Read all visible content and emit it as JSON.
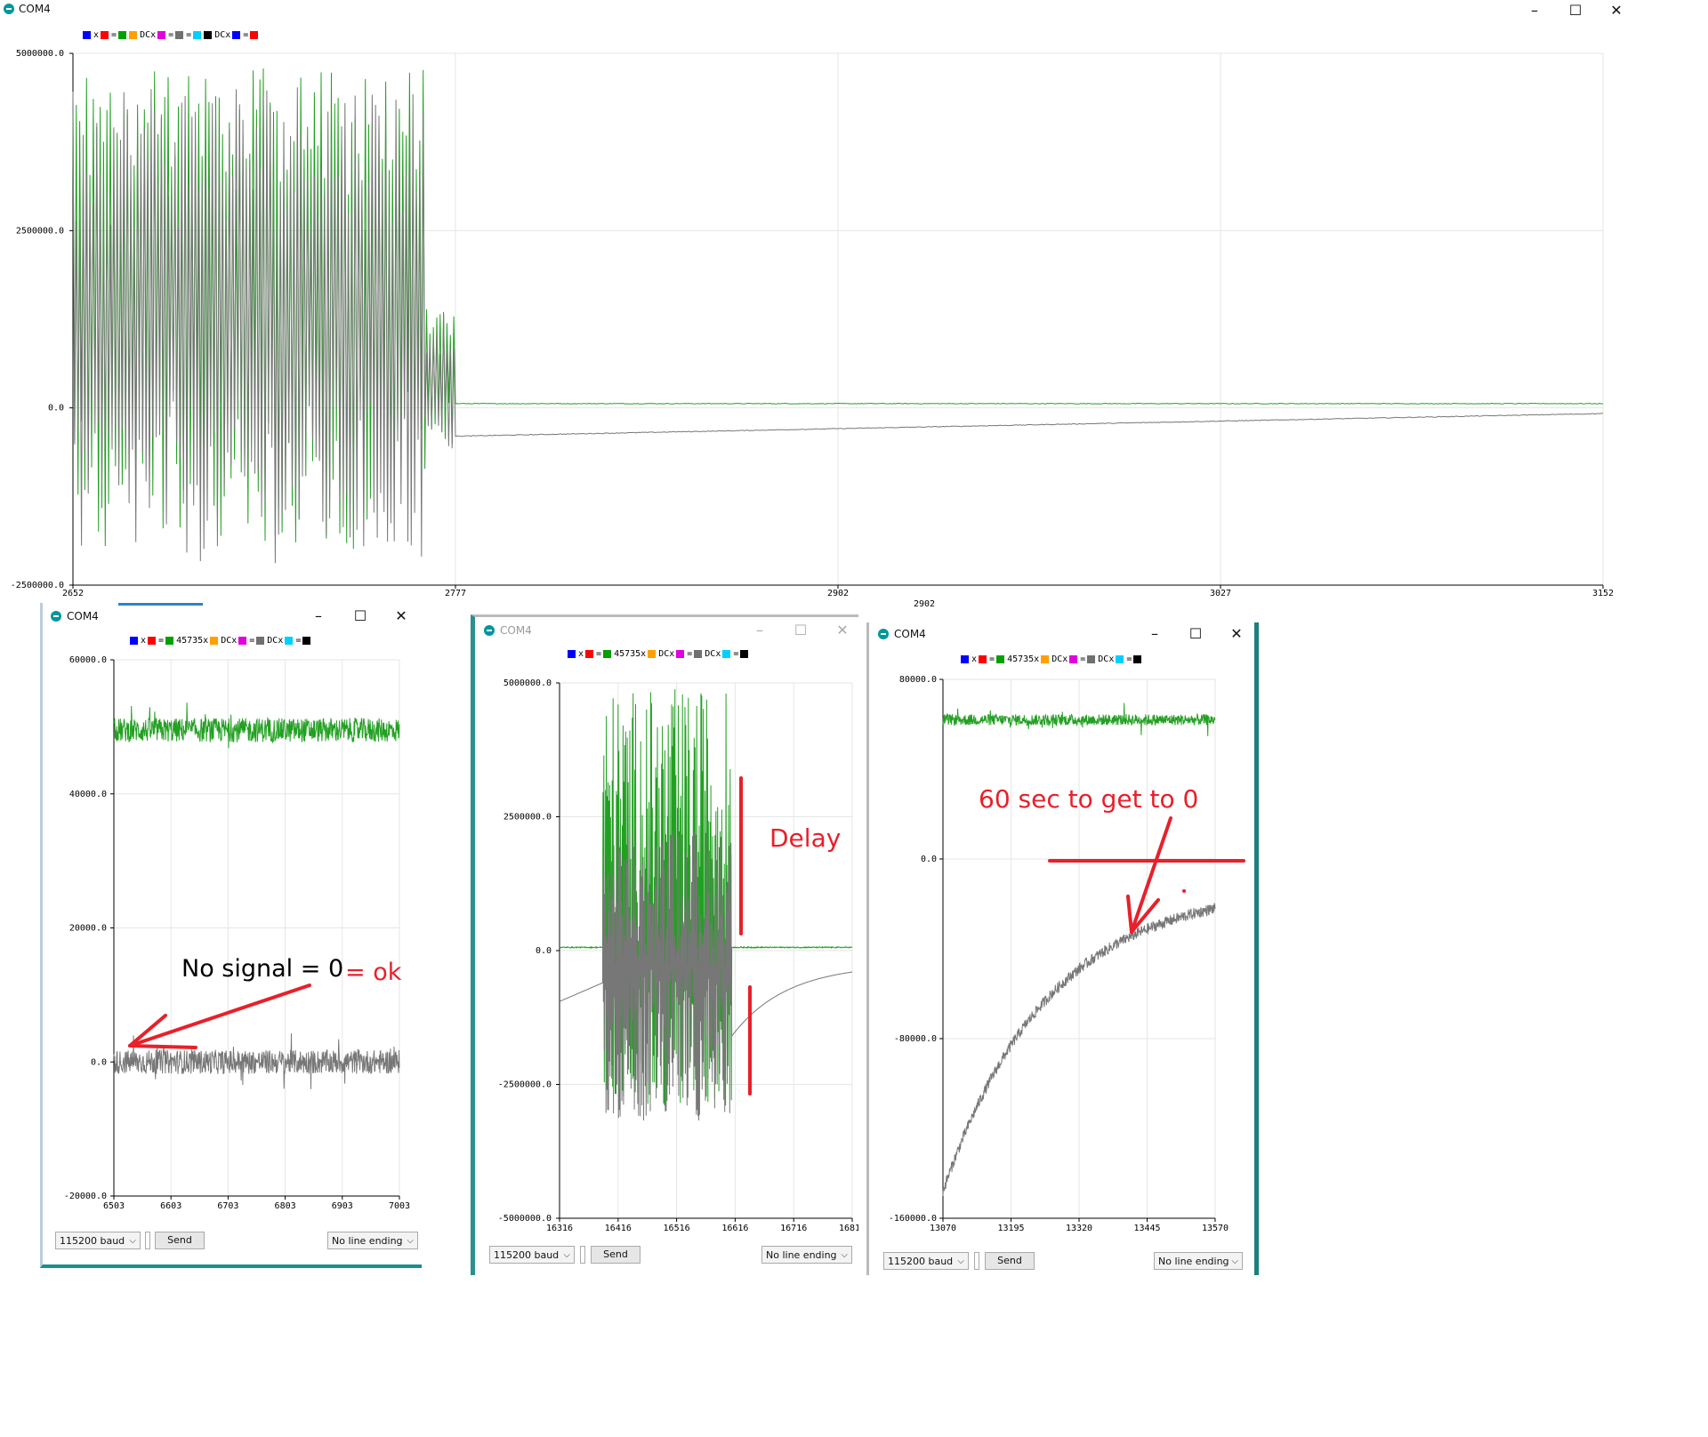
{
  "main": {
    "title": "COM4",
    "legend": [
      {
        "c": "#0000ff"
      },
      {
        "t": "x"
      },
      {
        "c": "#ff0000"
      },
      {
        "t": "="
      },
      {
        "c": "#00a000"
      },
      {
        "c": "#ffa000"
      },
      {
        "t": "DCx"
      },
      {
        "c": "#e000e0"
      },
      {
        "t": "="
      },
      {
        "c": "#707070"
      },
      {
        "t": "="
      },
      {
        "c": "#00d0ff"
      },
      {
        "c": "#000000"
      },
      {
        "t": "DCx"
      },
      {
        "c": "#0000ff"
      },
      {
        "t": "="
      },
      {
        "c": "#ff0000"
      }
    ],
    "chart_data": {
      "type": "line",
      "ylim": [
        -2500000,
        5000000
      ],
      "yticks": [
        "5000000.0",
        "2500000.0",
        "0.0",
        "-2500000.0"
      ],
      "xlim": [
        2652,
        3152
      ],
      "xticks": [
        "2652",
        "2777",
        "2902",
        "3027",
        "3152"
      ],
      "xtick_extra": "2902",
      "series": [
        {
          "color": "#22a022",
          "pattern": "burst-then-flat",
          "burst_end": 2777,
          "flat_value": 60000
        },
        {
          "color": "#777777",
          "pattern": "burst-then-recover",
          "burst_end": 2777,
          "start_value": -400000,
          "end_value": -80000
        }
      ]
    }
  },
  "win1": {
    "title": "COM4",
    "legend": [
      {
        "c": "#0000ff"
      },
      {
        "t": "x"
      },
      {
        "c": "#ff0000"
      },
      {
        "t": "="
      },
      {
        "c": "#00a000"
      },
      {
        "t": "45735x"
      },
      {
        "c": "#ffa000"
      },
      {
        "t": "DCx"
      },
      {
        "c": "#e000e0"
      },
      {
        "t": "="
      },
      {
        "c": "#707070"
      },
      {
        "t": "DCx"
      },
      {
        "c": "#00d0ff"
      },
      {
        "t": "="
      },
      {
        "c": "#000000"
      }
    ],
    "chart_data": {
      "type": "line",
      "ylim": [
        -20000,
        60000
      ],
      "yticks": [
        "60000.0",
        "40000.0",
        "20000.0",
        "0.0",
        "-20000.0"
      ],
      "xlim": [
        6503,
        7003
      ],
      "xticks": [
        "6503",
        "6603",
        "6703",
        "6803",
        "6903",
        "7003"
      ],
      "series": [
        {
          "color": "#22a022",
          "pattern": "noise",
          "mean": 49500,
          "amp": 1800
        },
        {
          "color": "#777777",
          "pattern": "noise",
          "mean": 0,
          "amp": 1800
        }
      ]
    },
    "annotation": {
      "text1": "No signal = 0",
      "text2": "= ok"
    },
    "bottom": {
      "baud": "115200 baud",
      "send": "Send",
      "ending": "No line ending"
    }
  },
  "win2": {
    "title": "COM4",
    "legend": [
      {
        "c": "#0000ff"
      },
      {
        "t": "x"
      },
      {
        "c": "#ff0000"
      },
      {
        "t": "="
      },
      {
        "c": "#00a000"
      },
      {
        "t": "45735x"
      },
      {
        "c": "#ffa000"
      },
      {
        "t": "DCx"
      },
      {
        "c": "#e000e0"
      },
      {
        "t": "="
      },
      {
        "c": "#707070"
      },
      {
        "t": "DCx"
      },
      {
        "c": "#00d0ff"
      },
      {
        "t": "="
      },
      {
        "c": "#000000"
      }
    ],
    "chart_data": {
      "type": "line",
      "ylim": [
        -5000000,
        5000000
      ],
      "yticks": [
        "5000000.0",
        "2500000.0",
        "0.0",
        "-2500000.0",
        "-5000000.0"
      ],
      "xlim": [
        16316,
        16816
      ],
      "xticks": [
        "16316",
        "16416",
        "16516",
        "16616",
        "16716",
        "16816"
      ],
      "series": [
        {
          "color": "#22a022",
          "pattern": "flat-burst-flat",
          "burst": [
            16390,
            16610
          ],
          "flat_value": 60000
        },
        {
          "color": "#777777",
          "pattern": "decay-burst-recover",
          "burst": [
            16390,
            16610
          ],
          "start_value": -950000,
          "end_value": -400000
        }
      ]
    },
    "annotation": {
      "text": "Delay"
    },
    "bottom": {
      "baud": "115200 baud",
      "send": "Send",
      "ending": "No line ending"
    }
  },
  "win3": {
    "title": "COM4",
    "legend": [
      {
        "c": "#0000ff"
      },
      {
        "t": "x"
      },
      {
        "c": "#ff0000"
      },
      {
        "t": "="
      },
      {
        "c": "#00a000"
      },
      {
        "t": "45735x"
      },
      {
        "c": "#ffa000"
      },
      {
        "t": "DCx"
      },
      {
        "c": "#e000e0"
      },
      {
        "t": "="
      },
      {
        "c": "#707070"
      },
      {
        "t": "DCx"
      },
      {
        "c": "#00d0ff"
      },
      {
        "t": "="
      },
      {
        "c": "#000000"
      }
    ],
    "chart_data": {
      "type": "line",
      "ylim": [
        -160000,
        80000
      ],
      "yticks": [
        "80000.0",
        "0.0",
        "-80000.0",
        "-160000.0"
      ],
      "xlim": [
        13070,
        13570
      ],
      "xticks": [
        "13070",
        "13195",
        "13320",
        "13445",
        "13570"
      ],
      "series": [
        {
          "color": "#22a022",
          "pattern": "noise",
          "mean": 62000,
          "amp": 2500
        },
        {
          "color": "#777777",
          "pattern": "exp-recover",
          "start_value": -148000,
          "end_value": -22000,
          "amp": 2500
        }
      ]
    },
    "annotation": {
      "text": "60 sec to get to 0"
    },
    "bottom": {
      "baud": "115200 baud",
      "send": "Send",
      "ending": "No line ending"
    }
  },
  "icons": {
    "minimize": "minimize-icon",
    "maximize": "maximize-icon",
    "close": "close-icon"
  },
  "glyphs": {
    "minimize": "–",
    "maximize": "☐",
    "close": "✕",
    "chevron": "⌵"
  }
}
